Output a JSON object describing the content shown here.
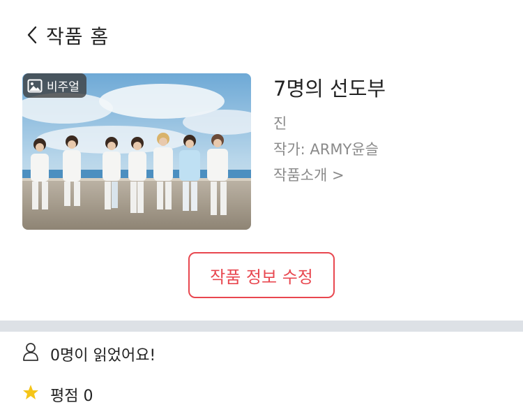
{
  "header": {
    "back_icon": "chevron-left-icon",
    "title": "작품 홈"
  },
  "work": {
    "badge_icon": "image-icon",
    "badge_label": "비주얼",
    "title": "7명의 선도부",
    "genre": "진",
    "author": "작가: ARMY윤슬",
    "intro_link": "작품소개 >"
  },
  "actions": {
    "edit_label": "작품 정보 수정"
  },
  "stats": {
    "readers_icon": "person-icon",
    "readers_text": "0명이 읽었어요!",
    "rating_icon": "star-icon",
    "rating_text": "평점 0"
  },
  "colors": {
    "accent": "#e8474f",
    "divider": "#dde1e6",
    "muted_text": "#8a8a8a",
    "star": "#f5c518"
  }
}
